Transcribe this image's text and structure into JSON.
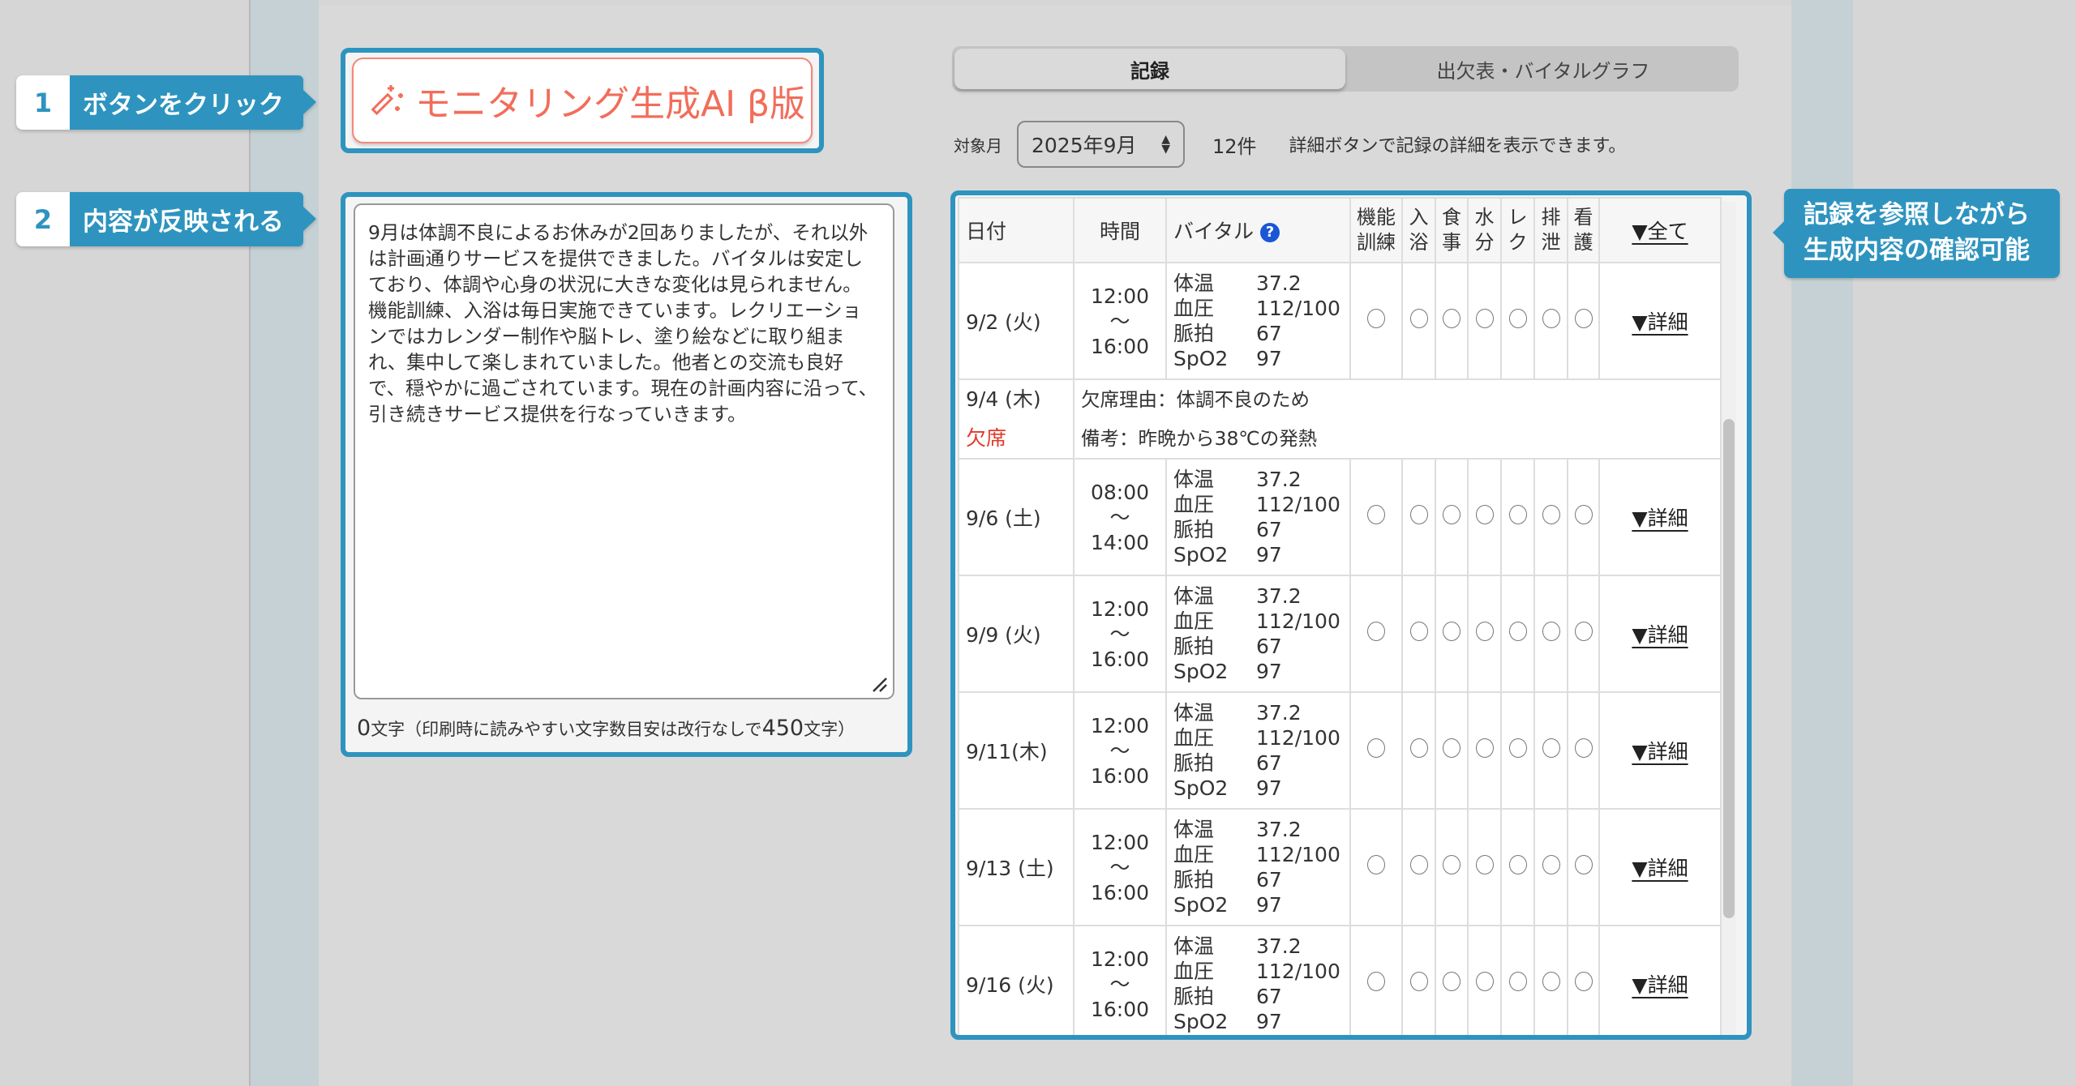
{
  "callouts": [
    {
      "num": "1",
      "label": "ボタンをクリック"
    },
    {
      "num": "2",
      "label": "内容が反映される"
    },
    {
      "label_line1": "記録を参照しながら",
      "label_line2": "生成内容の確認可能"
    }
  ],
  "ai_button": {
    "label": "モニタリング生成AI β版",
    "icon": "magic-wand-icon",
    "color": "#f26d5b"
  },
  "textarea": {
    "value": "9月は体調不良によるお休みが2回ありましたが、それ以外は計画通りサービスを提供できました。バイタルは安定しており、体調や心身の状況に大きな変化は見られません。機能訓練、入浴は毎日実施できています。レクリエーションではカレンダー制作や脳トレ、塗り絵などに取り組まれ、集中して楽しまれていました。他者との交流も良好で、穏やかに過ごされています。現在の計画内容に沿って、引き続きサービス提供を行なっていきます。"
  },
  "counter": {
    "count": "0",
    "text1": "文字（印刷時に読みやすい文字数目安は改行なしで",
    "limit": "450",
    "text2": "文字）"
  },
  "tabs": [
    {
      "label": "記録",
      "active": true
    },
    {
      "label": "出欠表・バイタルグラフ",
      "active": false
    }
  ],
  "filter": {
    "label": "対象月",
    "month": "2025年9月",
    "count": "12件",
    "hint": "詳細ボタンで記録の詳細を表示できます。"
  },
  "table": {
    "headers": {
      "date": "日付",
      "time": "時間",
      "vitals": "バイタル",
      "help": "?",
      "checks": [
        "機能訓練",
        "入浴",
        "食事",
        "水分",
        "レク",
        "排泄",
        "看護"
      ],
      "all": "▼全て"
    },
    "vital_labels": [
      "体温",
      "血圧",
      "脈拍",
      "SpO2"
    ],
    "detail_label": "▼詳細",
    "rows": [
      {
        "date": "9/2 (火)",
        "start": "12:00",
        "sep": "〜",
        "end": "16:00",
        "vitals": [
          "37.2",
          "112/100",
          "67",
          "97"
        ]
      },
      {
        "date": "9/4 (木)",
        "absent": "欠席",
        "reason": "欠席理由：体調不良のため",
        "note": "備考：昨晩から38℃の発熱"
      },
      {
        "date": "9/6 (土)",
        "start": "08:00",
        "sep": "〜",
        "end": "14:00",
        "vitals": [
          "37.2",
          "112/100",
          "67",
          "97"
        ]
      },
      {
        "date": "9/9 (火)",
        "start": "12:00",
        "sep": "〜",
        "end": "16:00",
        "vitals": [
          "37.2",
          "112/100",
          "67",
          "97"
        ]
      },
      {
        "date": "9/11(木)",
        "start": "12:00",
        "sep": "〜",
        "end": "16:00",
        "vitals": [
          "37.2",
          "112/100",
          "67",
          "97"
        ]
      },
      {
        "date": "9/13 (土)",
        "start": "12:00",
        "sep": "〜",
        "end": "16:00",
        "vitals": [
          "37.2",
          "112/100",
          "67",
          "97"
        ]
      },
      {
        "date": "9/16 (火)",
        "start": "12:00",
        "sep": "〜",
        "end": "16:00",
        "vitals": [
          "37.2",
          "112/100",
          "67",
          "97"
        ]
      }
    ]
  },
  "colors": {
    "accent": "#2e94bf",
    "absent": "#e23a2a"
  }
}
